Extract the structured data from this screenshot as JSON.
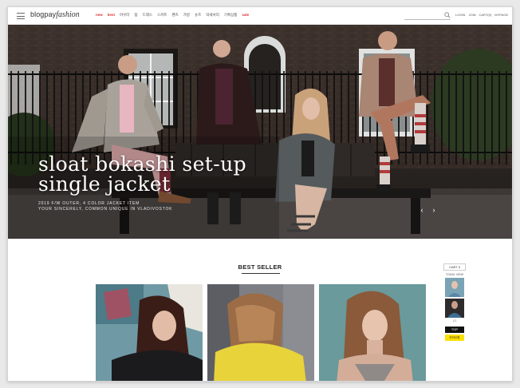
{
  "header": {
    "logo_brand": "blogpay",
    "logo_script": "fashion",
    "nav": [
      {
        "label": "new",
        "hot": true
      },
      {
        "label": "best",
        "hot": true
      },
      {
        "label": "아우터",
        "hot": false
      },
      {
        "label": "탑",
        "hot": false
      },
      {
        "label": "드레스",
        "hot": false
      },
      {
        "label": "스커트",
        "hot": false
      },
      {
        "label": "팬츠",
        "hot": false
      },
      {
        "label": "가방",
        "hot": false
      },
      {
        "label": "슈즈",
        "hot": false
      },
      {
        "label": "악세서리",
        "hot": false
      },
      {
        "label": "기획상품",
        "hot": false
      },
      {
        "label": "sale",
        "hot": true
      }
    ],
    "search_placeholder": "",
    "utilities": [
      "LOGIN",
      "JOIN",
      "CART(0)",
      "MYPAGE"
    ]
  },
  "hero": {
    "title_line1": "sloat bokashi set-up",
    "title_line2": "single jacket",
    "subtitle_line1": "2019 F/W OUTER, 4 COLOR JACKET ITEM",
    "subtitle_line2": "YOUR SINCERELY, COMMON UNIQUE IN VLADIVOSTOK",
    "prev": "‹",
    "next": "›"
  },
  "best_seller": {
    "title": "BEST SELLER"
  },
  "sidebar": {
    "cart_label": "CART",
    "cart_count": "0",
    "today_view": "TODAY VIEW",
    "pager": "1/2",
    "top_label": "TOP",
    "talk_label": "카카오톡"
  },
  "colors": {
    "accent_hot": "#dd3333",
    "kakao_yellow": "#f9e000",
    "text": "#222222"
  },
  "icons": [
    "hamburger-icon",
    "search-icon",
    "chevron-left-icon",
    "chevron-right-icon"
  ]
}
